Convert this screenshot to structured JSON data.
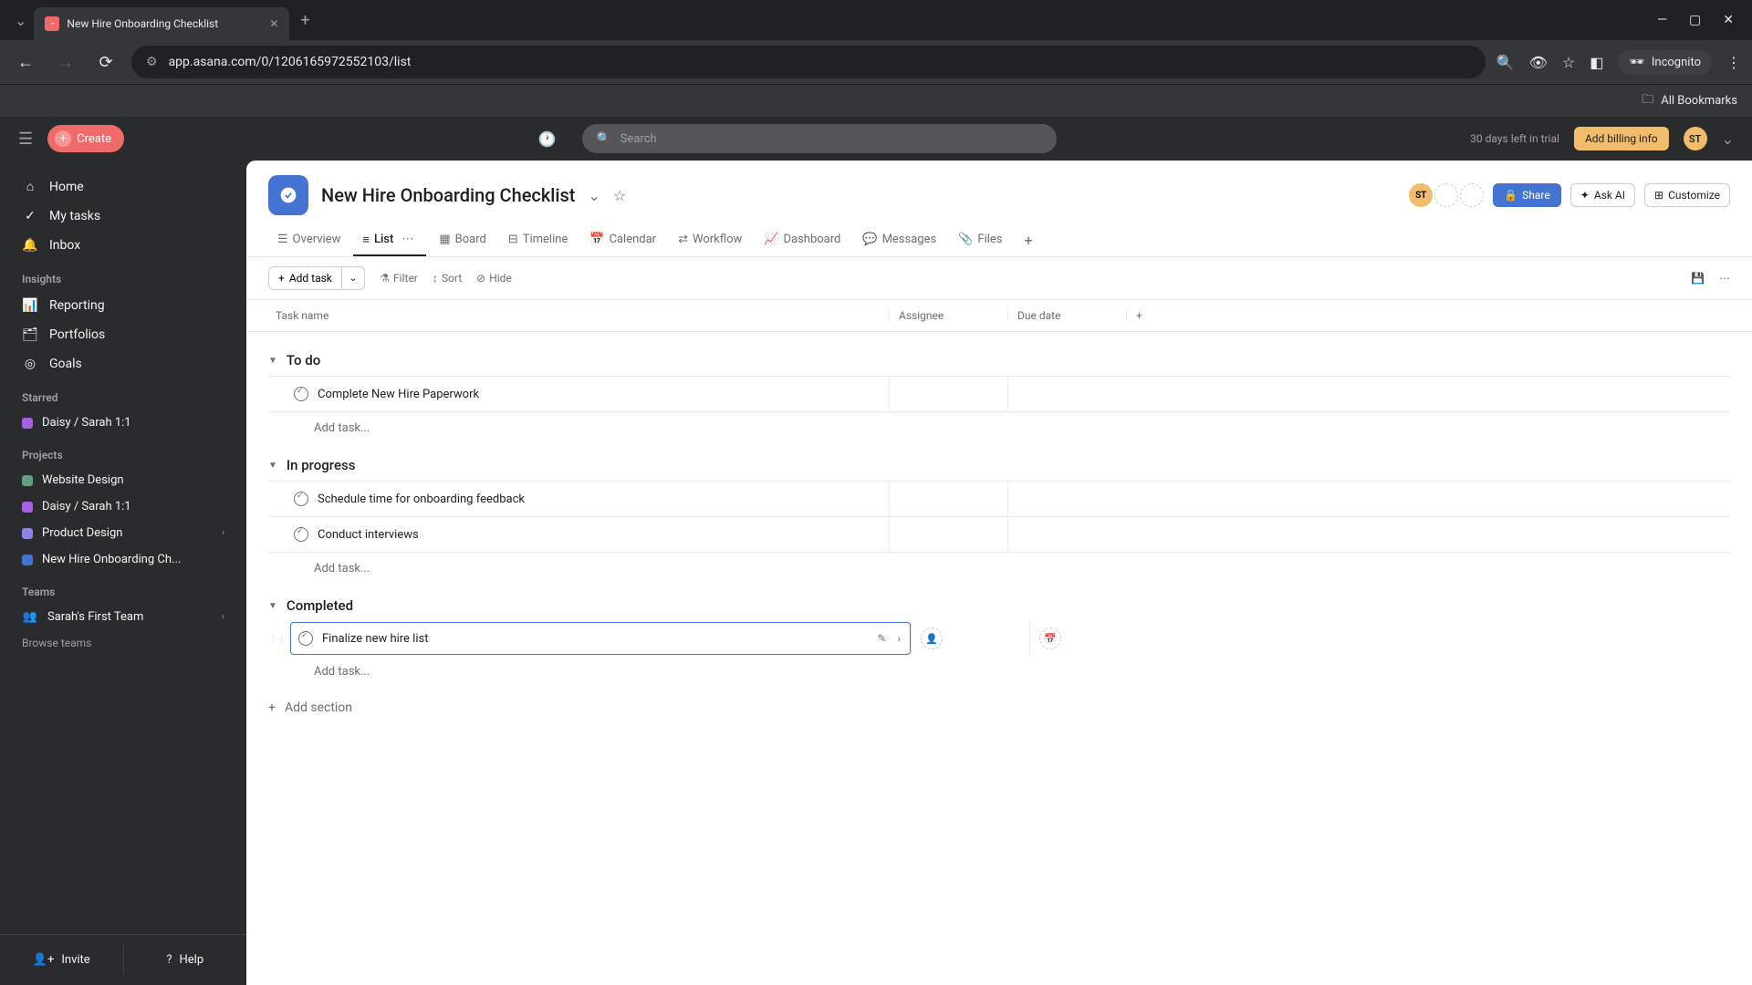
{
  "browser": {
    "tab_title": "New Hire Onboarding Checklist",
    "url": "app.asana.com/0/1206165972552103/list",
    "incognito_label": "Incognito",
    "all_bookmarks": "All Bookmarks"
  },
  "header": {
    "create_label": "Create",
    "search_placeholder": "Search",
    "trial_text": "30 days left in trial",
    "billing_label": "Add billing info",
    "user_initials": "ST"
  },
  "sidebar": {
    "nav": [
      {
        "label": "Home",
        "icon": "home"
      },
      {
        "label": "My tasks",
        "icon": "check"
      },
      {
        "label": "Inbox",
        "icon": "bell"
      }
    ],
    "sections": {
      "insights_label": "Insights",
      "insights": [
        {
          "label": "Reporting"
        },
        {
          "label": "Portfolios"
        },
        {
          "label": "Goals"
        }
      ],
      "starred_label": "Starred",
      "starred": [
        {
          "label": "Daisy / Sarah 1:1",
          "color": "#a362e0"
        }
      ],
      "projects_label": "Projects",
      "projects": [
        {
          "label": "Website Design",
          "color": "#5da283"
        },
        {
          "label": "Daisy / Sarah 1:1",
          "color": "#a362e0"
        },
        {
          "label": "Product Design",
          "color": "#8d84e8",
          "has_chevron": true
        },
        {
          "label": "New Hire Onboarding Ch...",
          "color": "#4573d2"
        }
      ],
      "teams_label": "Teams",
      "teams": [
        {
          "label": "Sarah's First Team",
          "has_chevron": true
        }
      ],
      "browse_teams": "Browse teams"
    },
    "footer": {
      "invite": "Invite",
      "help": "Help"
    }
  },
  "project": {
    "title": "New Hire Onboarding Checklist",
    "member_initials": "ST",
    "share_label": "Share",
    "ask_ai_label": "Ask AI",
    "customize_label": "Customize",
    "tabs": [
      "Overview",
      "List",
      "Board",
      "Timeline",
      "Calendar",
      "Workflow",
      "Dashboard",
      "Messages",
      "Files"
    ],
    "active_tab": "List",
    "toolbar": {
      "add_task": "Add task",
      "filter": "Filter",
      "sort": "Sort",
      "hide": "Hide"
    },
    "columns": {
      "task": "Task name",
      "assignee": "Assignee",
      "due_date": "Due date"
    },
    "sections": [
      {
        "name": "To do",
        "tasks": [
          {
            "name": "Complete New Hire Paperwork",
            "selected": false
          }
        ]
      },
      {
        "name": "In progress",
        "tasks": [
          {
            "name": "Schedule time for onboarding feedback",
            "selected": false
          },
          {
            "name": "Conduct interviews",
            "selected": false
          }
        ]
      },
      {
        "name": "Completed",
        "tasks": [
          {
            "name": "Finalize new hire list",
            "selected": true
          }
        ]
      }
    ],
    "add_task_placeholder": "Add task...",
    "add_section_label": "Add section"
  }
}
